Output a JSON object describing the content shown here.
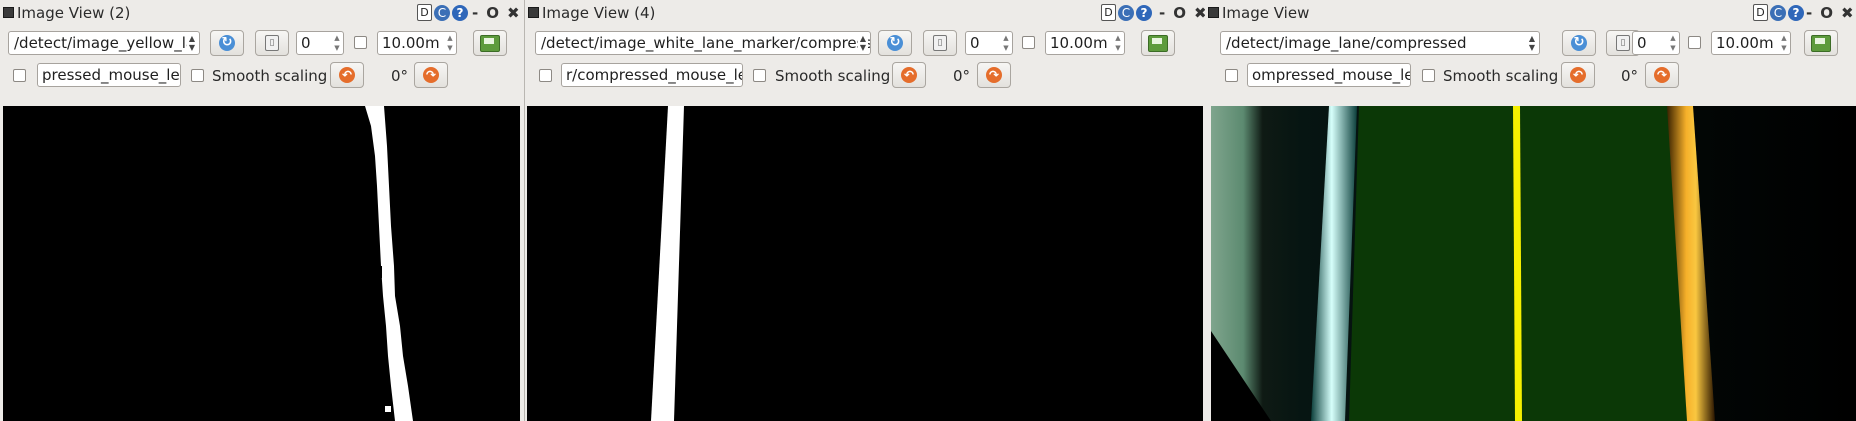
{
  "panels": [
    {
      "title": "Image View (2)",
      "topic": "/detect/image_yellow_la",
      "spin_value": "0",
      "duration": "10.00m",
      "mouse_topic": "pressed_mouse_left",
      "smooth_label": "Smooth scaling",
      "rotation": "0°",
      "title_icons": {
        "d": "D",
        "c": "C",
        "q": "?"
      },
      "window_controls": [
        "-",
        "O",
        "✖"
      ]
    },
    {
      "title": "Image View (4)",
      "topic": "/detect/image_white_lane_marker/compresse",
      "spin_value": "0",
      "duration": "10.00m",
      "mouse_topic": "r/compressed_mouse_left",
      "smooth_label": "Smooth scaling",
      "rotation": "0°",
      "title_icons": {
        "d": "D",
        "c": "C",
        "q": "?"
      },
      "window_controls": [
        "-",
        "O",
        "✖"
      ]
    },
    {
      "title": "Image View",
      "topic": "/detect/image_lane/compressed",
      "spin_value": "0",
      "duration": "10.00m",
      "mouse_topic": "ompressed_mouse_left",
      "smooth_label": "Smooth scaling",
      "rotation": "0°",
      "title_icons": {
        "d": "D",
        "c": "C",
        "q": "?"
      },
      "window_controls": [
        "-",
        "O",
        "✖"
      ]
    }
  ],
  "icons": {
    "refresh": "refresh-icon",
    "pause": "pause-icon",
    "save": "save-image-icon",
    "rotate_left": "rotate-left-icon",
    "rotate_right": "rotate-right-icon"
  },
  "colors": {
    "accent_blue": "#3b6fb6",
    "rotate_orange": "#e56d2b",
    "lane_green": "#0c3a05",
    "lane_yellow": "#f5f000",
    "lane_orange": "#f2a21e",
    "lane_cyan": "#bff7f2"
  }
}
